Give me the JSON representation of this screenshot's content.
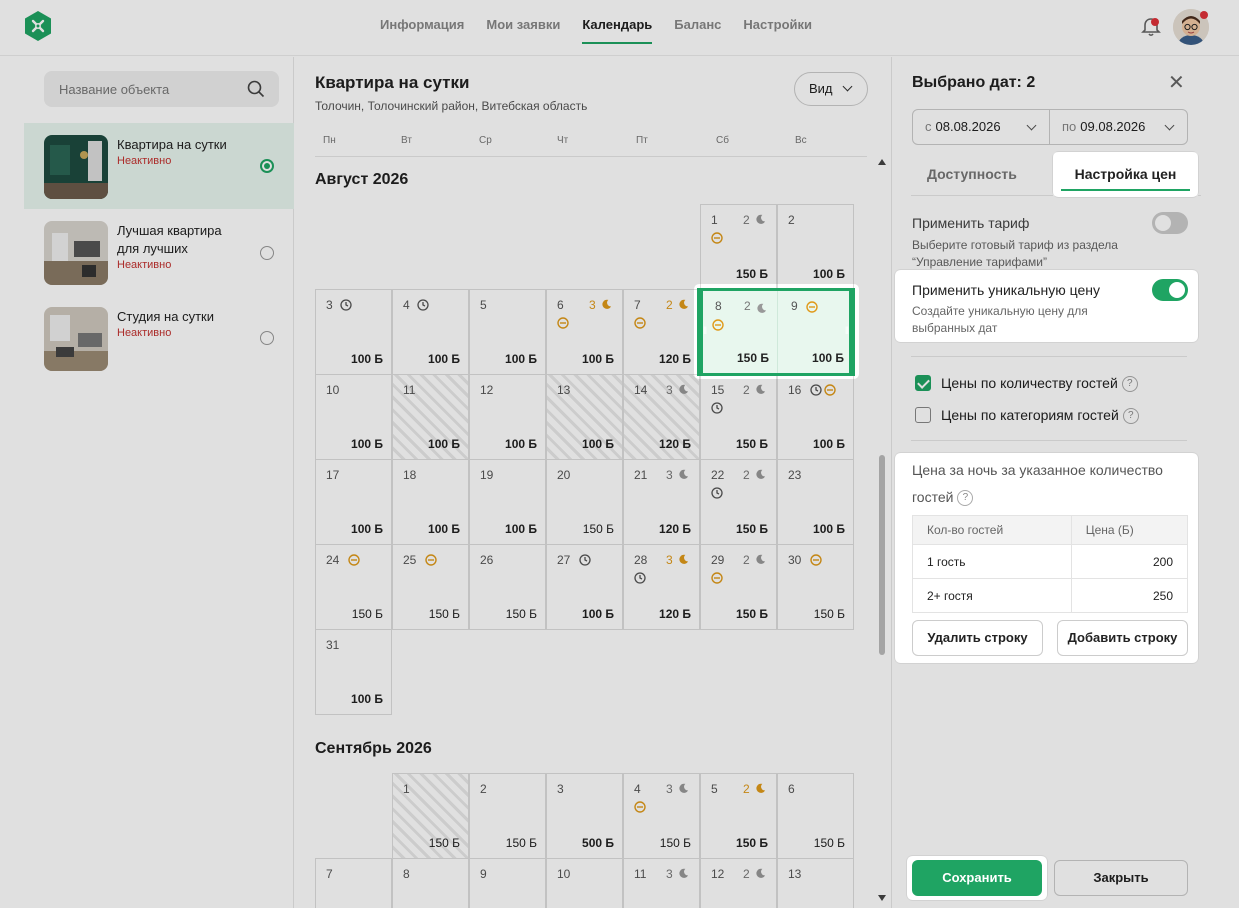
{
  "nav": {
    "items": [
      "Информация",
      "Мои заявки",
      "Календарь",
      "Баланс",
      "Настройки"
    ],
    "active": "Календарь"
  },
  "search": {
    "placeholder": "Название объекта"
  },
  "objects": [
    {
      "name": "Квартира на сутки",
      "status": "Неактивно",
      "selected": true
    },
    {
      "name": "Лучшая квартира для лучших",
      "status": "Неактивно",
      "selected": false
    },
    {
      "name": "Студия на сутки",
      "status": "Неактивно",
      "selected": false
    }
  ],
  "calendar": {
    "title": "Квартира на сутки",
    "address": "Толочин, Толочинский район, Витебская область",
    "view_label": "Вид",
    "weekdays": [
      "Пн",
      "Вт",
      "Ср",
      "Чт",
      "Пт",
      "Сб",
      "Вс"
    ],
    "months": [
      "Август 2026",
      "Сентябрь 2026"
    ],
    "august": [
      {
        "d": "1",
        "p": "150 Б",
        "b": true,
        "n": "2",
        "moon": "gray",
        "ic": [
          "minus"
        ]
      },
      {
        "d": "2",
        "p": "100 Б",
        "b": true
      },
      {
        "d": "3",
        "p": "100 Б",
        "b": true,
        "ic": [
          "clock"
        ]
      },
      {
        "d": "4",
        "p": "100 Б",
        "b": true,
        "ic": [
          "clock"
        ]
      },
      {
        "d": "5",
        "p": "100 Б",
        "b": true
      },
      {
        "d": "6",
        "p": "100 Б",
        "b": true,
        "n": "3",
        "moon": "orange",
        "ic": [
          "minus"
        ]
      },
      {
        "d": "7",
        "p": "120 Б",
        "b": true,
        "n": "2",
        "moon": "orange",
        "ic": [
          "minus"
        ]
      },
      {
        "d": "8",
        "p": "150 Б",
        "b": true,
        "n": "2",
        "moon": "gray",
        "ic": [
          "minus"
        ]
      },
      {
        "d": "9",
        "p": "100 Б",
        "b": true,
        "ic": [
          "minus"
        ]
      },
      {
        "d": "10",
        "p": "100 Б",
        "b": true
      },
      {
        "d": "11",
        "p": "100 Б",
        "b": true,
        "stripe": true
      },
      {
        "d": "12",
        "p": "100 Б",
        "b": true
      },
      {
        "d": "13",
        "p": "100 Б",
        "b": true,
        "stripe": true
      },
      {
        "d": "14",
        "p": "120 Б",
        "b": true,
        "n": "3",
        "moon": "gray",
        "stripe": true
      },
      {
        "d": "15",
        "p": "150 Б",
        "b": true,
        "n": "2",
        "moon": "gray",
        "ic": [
          "clock"
        ]
      },
      {
        "d": "16",
        "p": "100 Б",
        "b": true,
        "ic": [
          "clock",
          "minus"
        ]
      },
      {
        "d": "17",
        "p": "100 Б",
        "b": true
      },
      {
        "d": "18",
        "p": "100 Б",
        "b": true
      },
      {
        "d": "19",
        "p": "100 Б",
        "b": true
      },
      {
        "d": "20",
        "p": "150 Б",
        "b": false
      },
      {
        "d": "21",
        "p": "120 Б",
        "b": true,
        "n": "3",
        "moon": "gray"
      },
      {
        "d": "22",
        "p": "150 Б",
        "b": true,
        "n": "2",
        "moon": "gray",
        "ic": [
          "clock"
        ]
      },
      {
        "d": "23",
        "p": "100 Б",
        "b": true
      },
      {
        "d": "24",
        "p": "150 Б",
        "b": false,
        "ic": [
          "minus"
        ]
      },
      {
        "d": "25",
        "p": "150 Б",
        "b": false,
        "ic": [
          "minus"
        ]
      },
      {
        "d": "26",
        "p": "150 Б",
        "b": false
      },
      {
        "d": "27",
        "p": "100 Б",
        "b": true,
        "ic": [
          "clock"
        ]
      },
      {
        "d": "28",
        "p": "120 Б",
        "b": true,
        "n": "3",
        "moon": "orange",
        "ic": [
          "clock"
        ]
      },
      {
        "d": "29",
        "p": "150 Б",
        "b": true,
        "n": "2",
        "moon": "gray",
        "ic": [
          "minus"
        ]
      },
      {
        "d": "30",
        "p": "150 Б",
        "b": false,
        "ic": [
          "minus"
        ]
      },
      {
        "d": "31",
        "p": "100 Б",
        "b": true
      }
    ],
    "september": [
      {
        "d": "1",
        "p": "150 Б",
        "b": false,
        "stripe": true
      },
      {
        "d": "2",
        "p": "150 Б",
        "b": false
      },
      {
        "d": "3",
        "p": "500 Б",
        "b": true
      },
      {
        "d": "4",
        "p": "150 Б",
        "b": false,
        "n": "3",
        "moon": "gray",
        "ic": [
          "minus"
        ]
      },
      {
        "d": "5",
        "p": "150 Б",
        "b": true,
        "n": "2",
        "moon": "orange"
      },
      {
        "d": "6",
        "p": "150 Б",
        "b": false
      },
      {
        "d": "7"
      },
      {
        "d": "8"
      },
      {
        "d": "9"
      },
      {
        "d": "10"
      },
      {
        "d": "11",
        "n": "3",
        "moon": "gray"
      },
      {
        "d": "12",
        "n": "2",
        "moon": "gray"
      },
      {
        "d": "13"
      }
    ]
  },
  "panel": {
    "title": "Выбрано дат: 2",
    "from_label": "с",
    "from_date": "08.08.2026",
    "to_label": "по",
    "to_date": "09.08.2026",
    "tabs": [
      "Доступность",
      "Настройка цен"
    ],
    "apply_tariff": "Применить тариф",
    "apply_tariff_desc": "Выберите готовый тариф из раздела “Управление тарифами”",
    "apply_unique": "Применить уникальную цену",
    "apply_unique_desc": "Создайте уникальную цену для выбранных дат",
    "by_guests": "Цены по количеству гостей",
    "by_categories": "Цены по категориям гостей",
    "price_title": "Цена за ночь за указанное количество гостей",
    "table_headers": [
      "Кол-во гостей",
      "Цена (Б)"
    ],
    "rows": [
      [
        "1 гость",
        "200"
      ],
      [
        "2+ гостя",
        "250"
      ]
    ],
    "delete_row": "Удалить строку",
    "add_row": "Добавить строку",
    "save": "Сохранить",
    "close": "Закрыть"
  },
  "colors": {
    "accent": "#1fa463",
    "inactive": "#c3312f",
    "warn": "#e09a1a"
  }
}
